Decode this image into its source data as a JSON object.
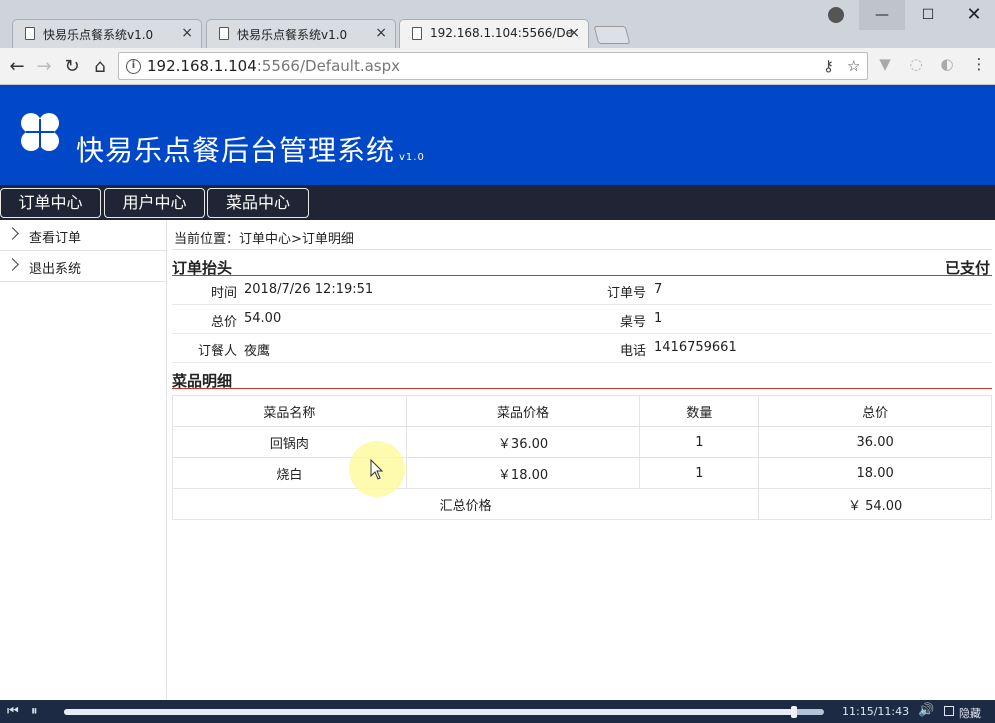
{
  "browser": {
    "tabs": [
      {
        "title": "快易乐点餐系统v1.0",
        "active": false
      },
      {
        "title": "快易乐点餐系统v1.0",
        "active": false
      },
      {
        "title": "192.168.1.104:5566/De",
        "active": true
      }
    ],
    "close_glyph": "×",
    "window": {
      "minimize": "—",
      "maximize": "☐",
      "close": "✕"
    },
    "url_host": "192.168.1.104",
    "url_rest": ":5566/Default.aspx"
  },
  "page": {
    "brand": "快易乐点餐后台管理系统",
    "version": "v1.0",
    "nav": [
      "订单中心",
      "用户中心",
      "菜品中心"
    ],
    "sidebar": [
      "查看订单",
      "退出系统"
    ],
    "breadcrumb": "当前位置：订单中心>订单明细",
    "order_header": {
      "title": "订单抬头",
      "status": "已支付",
      "time_label": "时间",
      "time_value": "2018/7/26 12:19:51",
      "order_no_label": "订单号",
      "order_no_value": "7",
      "total_label": "总价",
      "total_value": "54.00",
      "table_label": "桌号",
      "table_value": "1",
      "customer_label": "订餐人",
      "customer_value": "夜鹰",
      "phone_label": "电话",
      "phone_value": "1416759661"
    },
    "items": {
      "title": "菜品明细",
      "columns": [
        "菜品名称",
        "菜品价格",
        "数量",
        "总价"
      ],
      "rows": [
        {
          "name": "回锅肉",
          "price": "￥36.00",
          "qty": "1",
          "total": "36.00"
        },
        {
          "name": "烧白",
          "price": "￥18.00",
          "qty": "1",
          "total": "18.00"
        }
      ],
      "summary_label": "汇总价格",
      "summary_value": "￥ 54.00"
    }
  },
  "player": {
    "time": "11:15/11:43",
    "progress": 0.96,
    "hide_label": "隐藏"
  }
}
